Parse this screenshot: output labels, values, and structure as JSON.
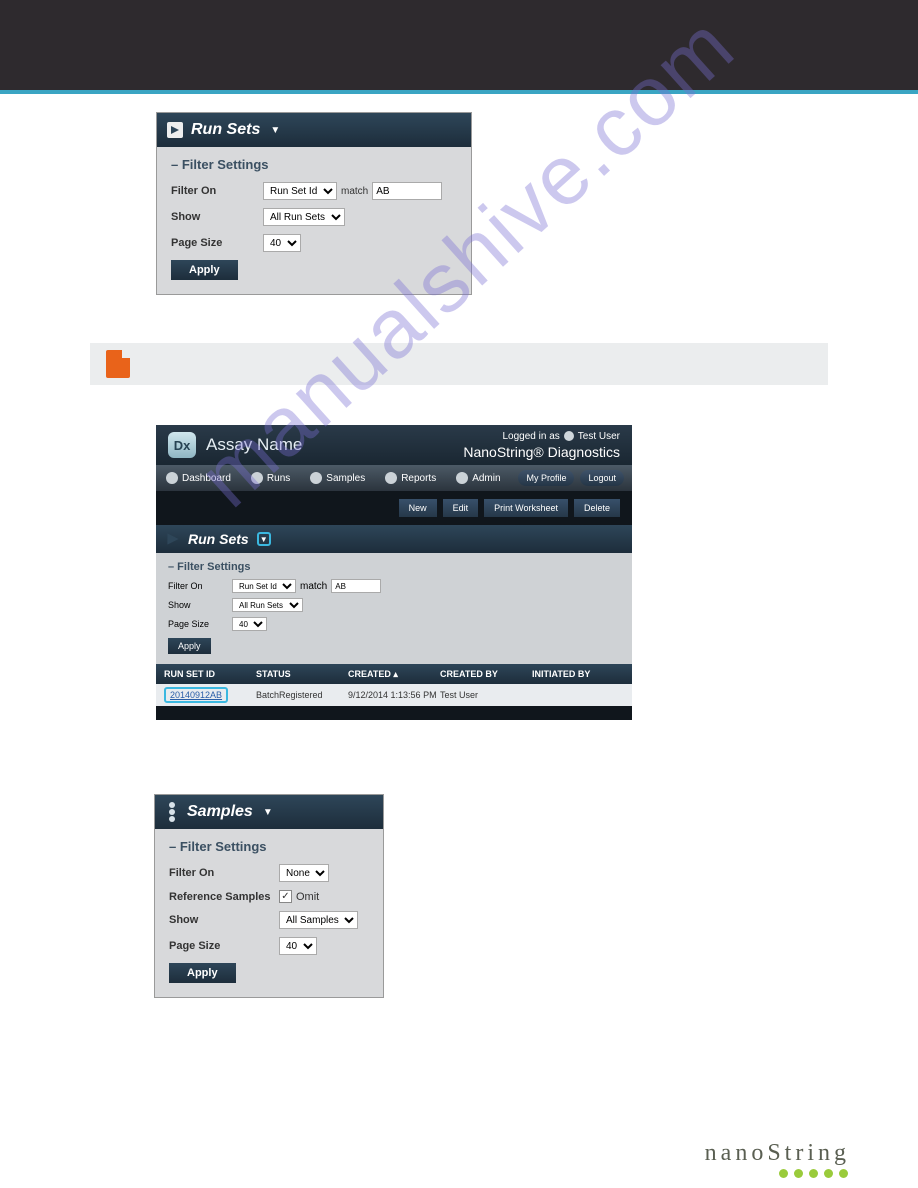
{
  "watermark_text": "manualshive.com",
  "panel1": {
    "title": "Run Sets",
    "filter_settings_label": "– Filter Settings",
    "filter_on_label": "Filter On",
    "filter_on_select": "Run Set Id",
    "match_label": "match",
    "match_value": "AB",
    "show_label": "Show",
    "show_select": "All Run Sets",
    "page_size_label": "Page Size",
    "page_size_select": "40",
    "apply_label": "Apply"
  },
  "app": {
    "dx_label": "Dx",
    "assay_name": "Assay Name",
    "logged_in_label": "Logged in as",
    "user_name": "Test User",
    "brand": "NanoString® Diagnostics",
    "menu": {
      "dashboard": "Dashboard",
      "runs": "Runs",
      "samples": "Samples",
      "reports": "Reports",
      "admin": "Admin",
      "my_profile": "My Profile",
      "logout": "Logout"
    },
    "actions": {
      "new": "New",
      "edit": "Edit",
      "print": "Print Worksheet",
      "delete": "Delete"
    },
    "runsets": {
      "title": "Run Sets",
      "filter_settings_label": "– Filter Settings",
      "filter_on_label": "Filter On",
      "filter_on_select": "Run Set Id",
      "match_label": "match",
      "match_value": "AB",
      "show_label": "Show",
      "show_select": "All Run Sets",
      "page_size_label": "Page Size",
      "page_size_select": "40",
      "apply_label": "Apply"
    },
    "table": {
      "cols": {
        "id": "RUN SET ID",
        "status": "STATUS",
        "created": "CREATED ▴",
        "created_by": "CREATED BY",
        "initiated_by": "INITIATED BY"
      },
      "row": {
        "id": "20140912AB",
        "status": "BatchRegistered",
        "created": "9/12/2014 1:13:56 PM",
        "created_by": "Test User",
        "initiated_by": ""
      }
    }
  },
  "panel3": {
    "title": "Samples",
    "filter_settings_label": "– Filter Settings",
    "filter_on_label": "Filter On",
    "filter_on_select": "None",
    "ref_label": "Reference Samples",
    "omit_label": "Omit",
    "show_label": "Show",
    "show_select": "All Samples",
    "page_size_label": "Page Size",
    "page_size_select": "40",
    "apply_label": "Apply"
  },
  "footer": {
    "brand": "nanoString"
  }
}
